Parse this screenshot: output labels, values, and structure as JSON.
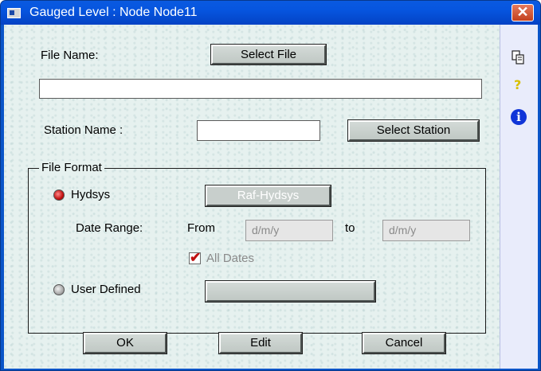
{
  "window": {
    "title": "Gauged Level : Node Node11",
    "close_symbol": "✕"
  },
  "file": {
    "name_label": "File Name:",
    "select_button": "Select File",
    "path_value": ""
  },
  "station": {
    "name_label": "Station Name :",
    "name_value": "",
    "select_button": "Select Station"
  },
  "file_format": {
    "legend": "File Format",
    "hydsys": {
      "label": "Hydsys",
      "selected": true,
      "raf_button": "Raf-Hydsys",
      "date_range_label": "Date Range:",
      "from_label": "From",
      "from_placeholder": "d/m/y",
      "to_label": "to",
      "to_placeholder": "d/m/y",
      "all_dates_label": "All Dates",
      "all_dates_checked": true
    },
    "user_defined": {
      "label": "User Defined",
      "selected": false,
      "button_label": ""
    }
  },
  "actions": {
    "ok": "OK",
    "edit": "Edit",
    "cancel": "Cancel"
  },
  "side_panel": {
    "icons": [
      "copy-icon",
      "help-icon",
      "info-icon"
    ],
    "help_glyph": "?",
    "info_glyph": "i"
  },
  "colors": {
    "titlebar": "#0a5ae0",
    "client_bg": "#e6f1ef",
    "radio_on": "#c21010",
    "info_icon": "#1035d8"
  }
}
